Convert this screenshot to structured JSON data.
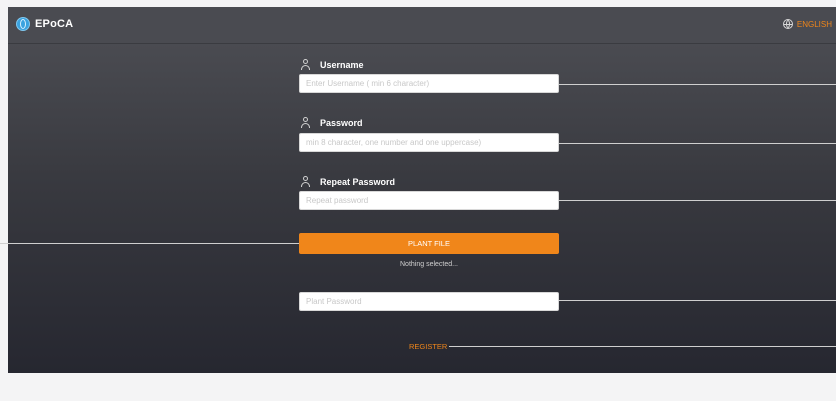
{
  "header": {
    "logo_text": "EPoCA",
    "language": "ENGLISH"
  },
  "form": {
    "username": {
      "label": "Username",
      "placeholder": "Enter Username ( min 6 character)",
      "icon": "user-icon"
    },
    "password": {
      "label": "Password",
      "placeholder": "min 8 character, one number and one uppercase)",
      "icon": "user-icon"
    },
    "repeat_password": {
      "label": "Repeat Password",
      "placeholder": "Repeat password",
      "icon": "user-icon"
    },
    "plant_file_button": "PLANT FILE",
    "file_status": "Nothing selected...",
    "plant_password": {
      "placeholder": "Plant Password"
    },
    "register_link": "REGISTER"
  },
  "colors": {
    "accent": "#f0861a",
    "header_bg": "#4a4b51",
    "logo_blue": "#3aa2df"
  }
}
